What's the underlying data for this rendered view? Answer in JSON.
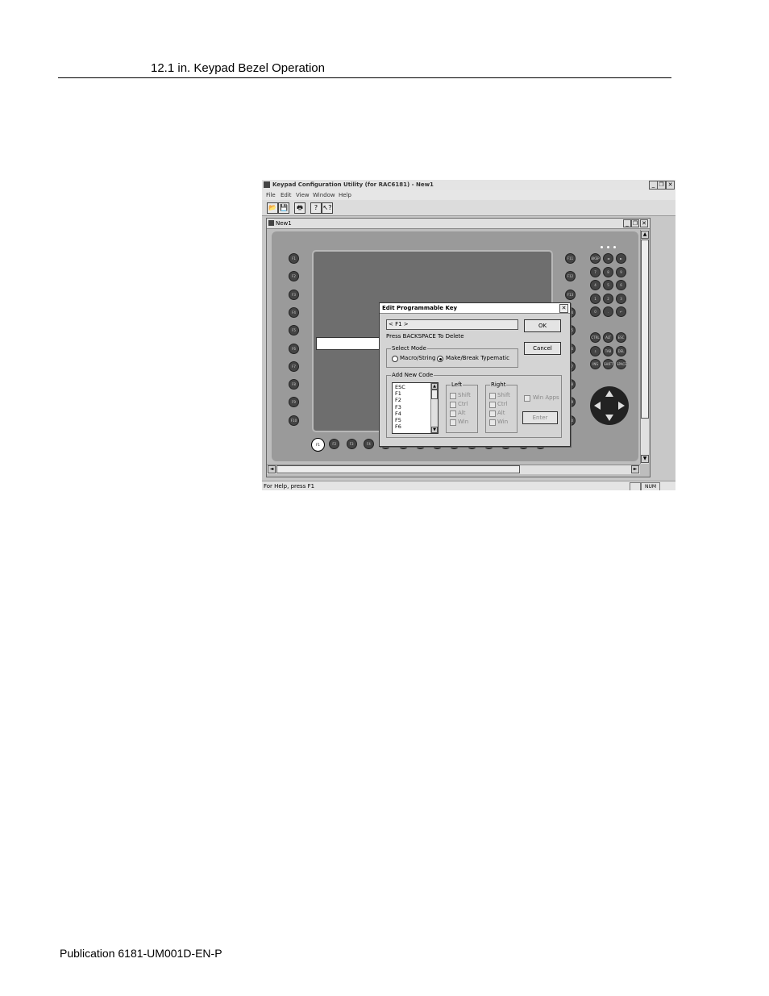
{
  "header": {
    "section_title": "12.1 in. Keypad Bezel Operation"
  },
  "footer": {
    "publication": "Publication 6181-UM001D-EN-P"
  },
  "app": {
    "title": "Keypad Configuration Utility (for RAC6181) - New1",
    "window_buttons": {
      "minimize": "_",
      "restore": "❐",
      "close": "✕"
    },
    "menu": [
      "File",
      "Edit",
      "View",
      "Window",
      "Help"
    ],
    "toolbar_icons": [
      "open-icon",
      "save-icon",
      "print-icon",
      "help-icon",
      "context-help-icon"
    ],
    "toolbar_glyphs": [
      "📂",
      "💾",
      "🖶",
      "?",
      "↖?"
    ],
    "document": {
      "title": "New1",
      "left_keys": [
        "F1",
        "F2",
        "F3",
        "F4",
        "F5",
        "F6",
        "F7",
        "F8",
        "F9",
        "F10"
      ],
      "right_keys": [
        "F11",
        "F12",
        "F13",
        "F14",
        "F15",
        "F16",
        "F17",
        "F18",
        "F19",
        "F20"
      ],
      "bottom_keys": [
        "F1",
        "F2",
        "F3",
        "F4",
        "F5",
        "F6",
        "F7",
        "F8",
        "F9",
        "F10",
        "F11",
        "F12",
        "F13",
        "F14"
      ],
      "numpad": [
        [
          "BKSP",
          "◄",
          "►"
        ],
        [
          "7",
          "8",
          "9"
        ],
        [
          "4",
          "5",
          "6"
        ],
        [
          "1",
          "2",
          "3"
        ],
        [
          "0",
          ".",
          "↵"
        ]
      ],
      "special_keys": [
        [
          "CTRL",
          "ALT",
          "ESC"
        ],
        [
          "⇩",
          "TAB",
          "DEL"
        ],
        [
          "INS",
          "SHIFT",
          "SPACE"
        ]
      ]
    },
    "statusbar": {
      "help_text": "For Help, press F1",
      "num_indicator": "NUM"
    }
  },
  "dialog": {
    "title": "Edit Programmable Key",
    "close_glyph": "✕",
    "key_value": "< F1 >",
    "backspace_hint": "Press BACKSPACE To Delete",
    "ok_label": "OK",
    "cancel_label": "Cancel",
    "select_mode": {
      "label": "Select Mode",
      "options": [
        "Macro/String",
        "Make/Break Typematic"
      ],
      "selected": "Make/Break Typematic"
    },
    "add_new_code": {
      "label": "Add New Code",
      "list": [
        "ESC",
        "F1",
        "F2",
        "F3",
        "F4",
        "F5",
        "F6"
      ],
      "left_group": {
        "label": "Left",
        "options": [
          "Shift",
          "Ctrl",
          "Alt",
          "Win"
        ]
      },
      "right_group": {
        "label": "Right",
        "options": [
          "Shift",
          "Ctrl",
          "Alt",
          "Win"
        ]
      },
      "win_apps_label": "Win Apps",
      "enter_label": "Enter"
    }
  }
}
